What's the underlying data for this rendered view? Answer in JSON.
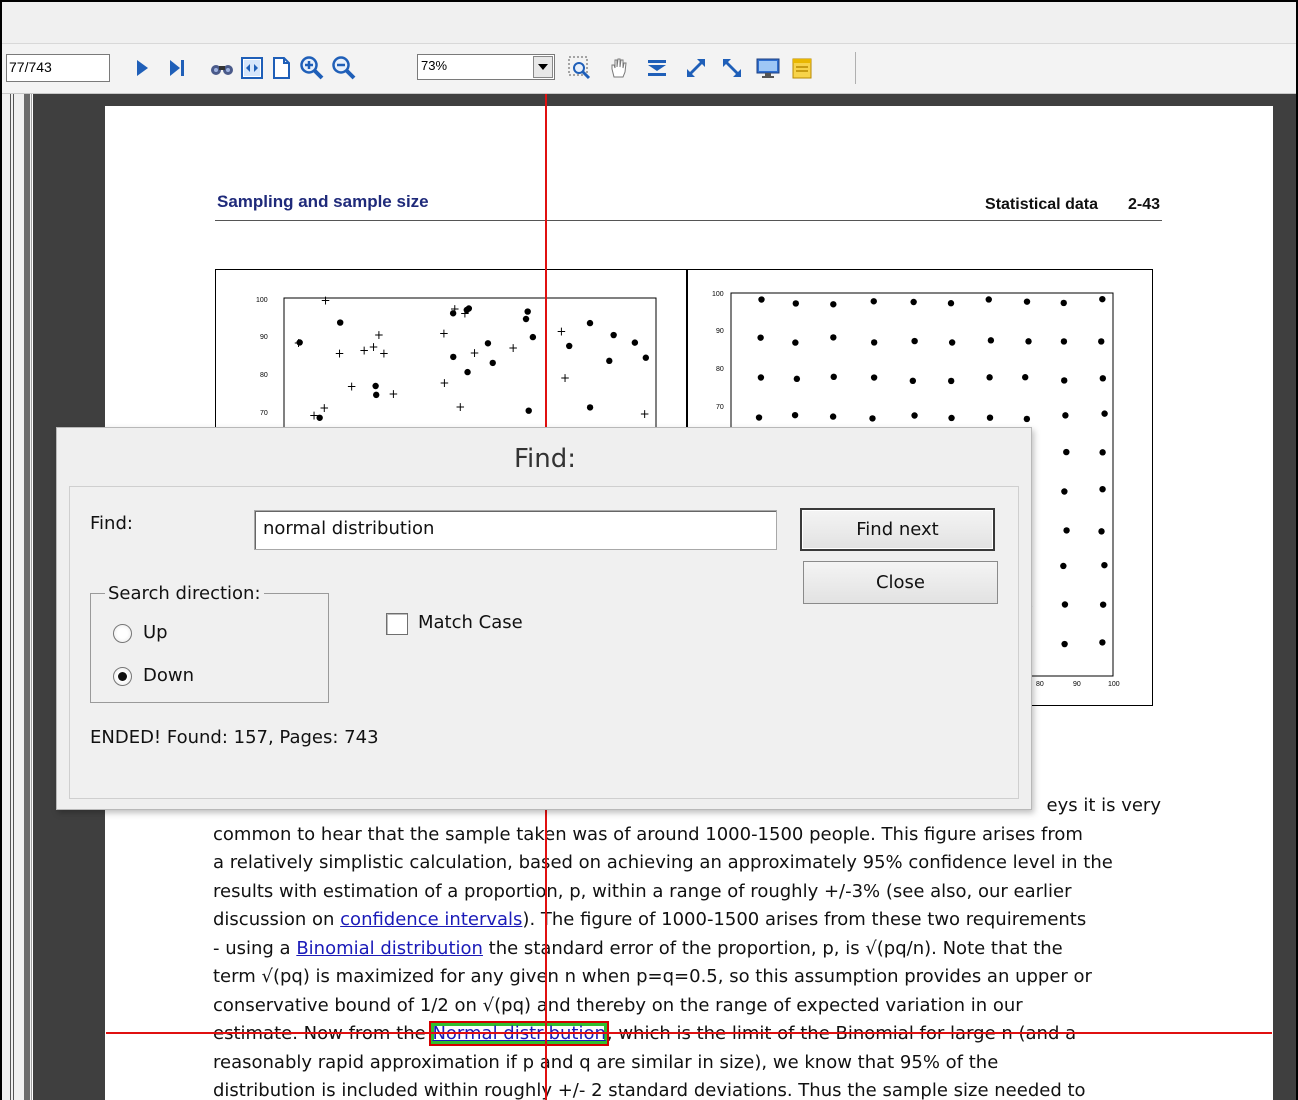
{
  "toolbar": {
    "page_field": "77/743",
    "zoom_value": "73%",
    "icons": [
      "next-page-icon",
      "last-page-icon",
      "find-binoculars-icon",
      "fit-width-icon",
      "fit-page-icon",
      "zoom-in-icon",
      "zoom-out-icon",
      "zoom-select-icon",
      "pan-hand-icon",
      "rotate-down-icon",
      "rotate-left-icon",
      "rotate-right-icon",
      "fullscreen-icon",
      "bookmark-icon"
    ]
  },
  "document": {
    "header_left": "Sampling and sample size",
    "header_right": "Statistical data",
    "page_number": "2-43",
    "left_plot": {
      "y_ticks": [
        "100",
        "90",
        "80",
        "70"
      ]
    },
    "right_plot": {
      "y_ticks": [
        "100",
        "90",
        "80",
        "70"
      ],
      "x_ticks": [
        "80",
        "90",
        "100"
      ]
    },
    "body": {
      "line1_tail": "eys it is very",
      "line2": "common to hear that the sample taken was of around 1000-1500 people. This figure arises from",
      "line3": "a relatively simplistic calculation, based on achieving an approximately 95% confidence level in the",
      "line4": "results with estimation of a proportion, p, within a range of roughly +/-3% (see also, our earlier",
      "line5_pre": "discussion on ",
      "link_confidence": "confidence intervals",
      "line5_post": "). The figure of 1000-1500 arises from these two requirements",
      "line6_pre": "- using a ",
      "link_binomial": "Binomial distribution",
      "line6_post": " the standard error of the proportion, p, is √(pq/n). Note that the",
      "line7": "term √(pq) is maximized for any given n when p=q=0.5, so this assumption provides an upper or",
      "line8": "conservative bound of 1/2 on √(pq) and thereby on the range of expected variation in our",
      "line9_pre": "estimate. Now from the ",
      "link_normal": "Normal distribution",
      "line9_post": ", which is the limit of the Binomial for large n (and a",
      "line10": "reasonably rapid approximation if p and q are similar in size), we know that 95% of the",
      "line11": "distribution is included within roughly +/- 2 standard deviations. Thus the sample size needed to"
    }
  },
  "find_dialog": {
    "title": "Find:",
    "find_label": "Find:",
    "find_value": "normal distribution",
    "find_next_label": "Find next",
    "close_label": "Close",
    "direction_legend": "Search direction:",
    "up_label": "Up",
    "down_label": "Down",
    "selected_direction": "Down",
    "match_case_label": "Match Case",
    "match_case_checked": false,
    "status": "ENDED! Found: 157, Pages: 743"
  }
}
